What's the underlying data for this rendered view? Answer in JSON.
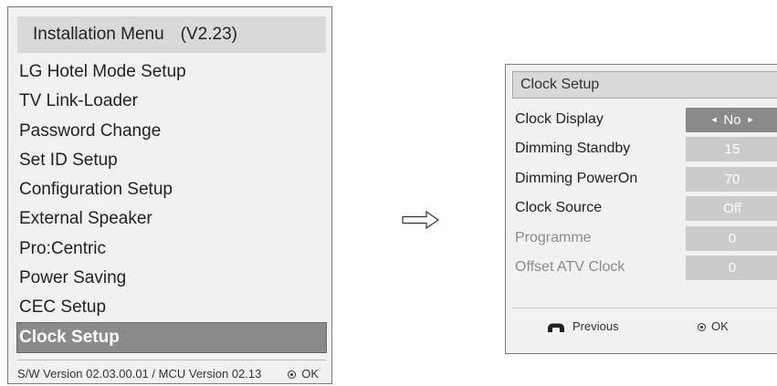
{
  "install_menu": {
    "title": "Installation Menu",
    "version": "(V2.23)",
    "items": [
      {
        "label": "LG Hotel Mode Setup"
      },
      {
        "label": "TV Link-Loader"
      },
      {
        "label": "Password Change"
      },
      {
        "label": "Set ID Setup"
      },
      {
        "label": "Configuration Setup"
      },
      {
        "label": "External Speaker"
      },
      {
        "label": "Pro:Centric"
      },
      {
        "label": "Power Saving"
      },
      {
        "label": "CEC Setup"
      },
      {
        "label": "Clock Setup",
        "selected": true
      }
    ],
    "footer": {
      "version_text": "S/W Version 02.03.00.01 / MCU Version 02.13",
      "ok_label": "OK"
    }
  },
  "arrow_icon": "right-arrow-outline",
  "clock_setup": {
    "title": "Clock Setup",
    "rows": [
      {
        "label": "Clock Display",
        "value": "No",
        "selected": true,
        "disabled": false
      },
      {
        "label": "Dimming Standby",
        "value": "15",
        "selected": false,
        "disabled": false
      },
      {
        "label": "Dimming PowerOn",
        "value": "70",
        "selected": false,
        "disabled": false
      },
      {
        "label": "Clock Source",
        "value": "Off",
        "selected": false,
        "disabled": false
      },
      {
        "label": "Programme",
        "value": "0",
        "selected": false,
        "disabled": true
      },
      {
        "label": "Offset ATV Clock",
        "value": "0",
        "selected": false,
        "disabled": true
      }
    ],
    "footer": {
      "previous_label": "Previous",
      "ok_label": "OK"
    }
  },
  "colors": {
    "selected_bg": "#8a8a8a",
    "value_bg": "#cbcbcb",
    "title_bg": "#d9d9d9",
    "panel_bg": "#f1f1f1",
    "disabled_text": "#8c8c8c"
  }
}
